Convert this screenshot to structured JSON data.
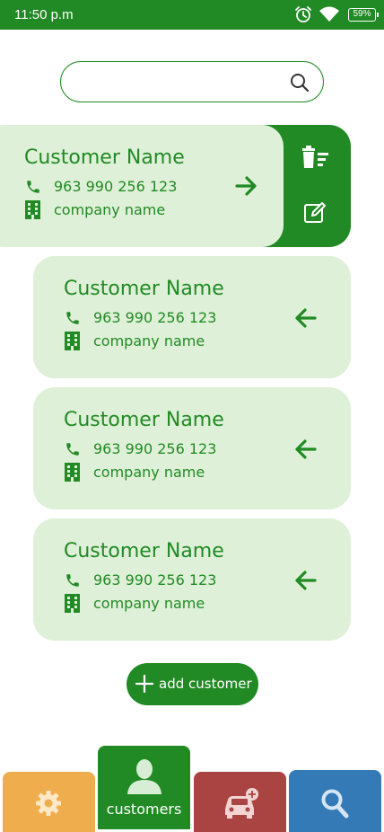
{
  "status_bar": {
    "time": "11:50 p.m",
    "battery": "59%",
    "icons": [
      "alarm-icon",
      "wifi-icon",
      "battery-icon"
    ]
  },
  "search": {
    "value": "",
    "placeholder": "",
    "icon": "search-icon"
  },
  "customers": [
    {
      "name": "Customer Name",
      "phone": "963 990 256 123",
      "company": "company name",
      "arrow": "arrow-right-icon",
      "expanded": true
    },
    {
      "name": "Customer Name",
      "phone": "963 990 256 123",
      "company": "company name",
      "arrow": "arrow-left-icon",
      "expanded": false
    },
    {
      "name": "Customer Name",
      "phone": "963 990 256 123",
      "company": "company name",
      "arrow": "arrow-left-icon",
      "expanded": false
    },
    {
      "name": "Customer Name",
      "phone": "963 990 256 123",
      "company": "company name",
      "arrow": "arrow-left-icon",
      "expanded": false
    }
  ],
  "card_actions": {
    "icons": [
      "delete-sweep-icon",
      "edit-icon"
    ]
  },
  "add_button": {
    "label": "add customer",
    "icon": "plus-icon"
  },
  "bottom_nav": {
    "tabs": [
      {
        "label": "",
        "icon": "gear-icon",
        "color": "#f0ad4e"
      },
      {
        "label": "customers",
        "icon": "person-icon",
        "color": "#218a24",
        "active": true
      },
      {
        "label": "",
        "icon": "car-add-icon",
        "color": "#a94442"
      },
      {
        "label": "",
        "icon": "search-icon",
        "color": "#337ab7"
      }
    ]
  },
  "colors": {
    "primary": "#218a24",
    "card_bg": "#dff0d8",
    "settings_tab": "#f0ad4e",
    "car_tab": "#a94442",
    "search_tab": "#337ab7"
  }
}
